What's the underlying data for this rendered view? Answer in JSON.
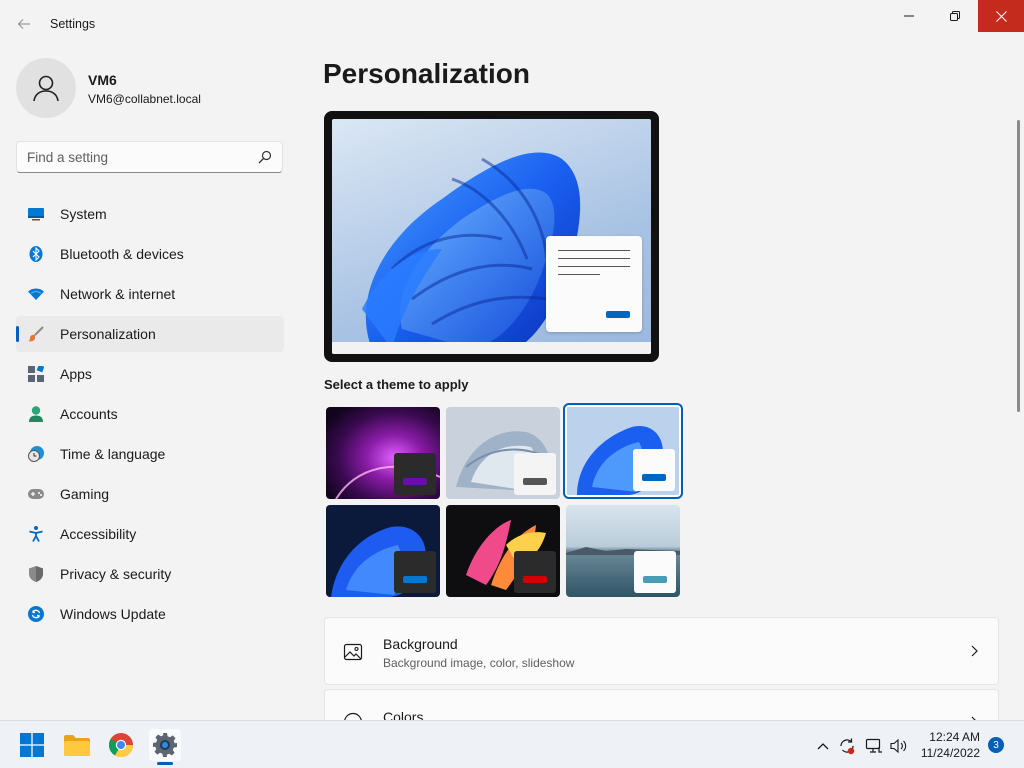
{
  "window": {
    "app_title": "Settings",
    "close_color": "#c42b1c"
  },
  "profile": {
    "name": "VM6",
    "email": "VM6@collabnet.local"
  },
  "search": {
    "placeholder": "Find a setting"
  },
  "sidebar": {
    "items": [
      {
        "label": "System",
        "icon": "system-icon"
      },
      {
        "label": "Bluetooth & devices",
        "icon": "bluetooth-icon"
      },
      {
        "label": "Network & internet",
        "icon": "wifi-icon"
      },
      {
        "label": "Personalization",
        "icon": "brush-icon",
        "active": true
      },
      {
        "label": "Apps",
        "icon": "apps-icon"
      },
      {
        "label": "Accounts",
        "icon": "accounts-icon"
      },
      {
        "label": "Time & language",
        "icon": "clock-globe-icon"
      },
      {
        "label": "Gaming",
        "icon": "gamepad-icon"
      },
      {
        "label": "Accessibility",
        "icon": "accessibility-icon"
      },
      {
        "label": "Privacy & security",
        "icon": "shield-icon"
      },
      {
        "label": "Windows Update",
        "icon": "update-icon"
      }
    ]
  },
  "main": {
    "page_title": "Personalization",
    "theme_heading": "Select a theme to apply",
    "themes": [
      {
        "id": "glow",
        "accent": "#6a0dad",
        "selected": false
      },
      {
        "id": "captured-motion",
        "accent": "#555555",
        "selected": false
      },
      {
        "id": "windows-light",
        "accent": "#0067c0",
        "selected": true
      },
      {
        "id": "windows-dark",
        "accent": "#0078d4",
        "selected": false
      },
      {
        "id": "flow",
        "accent": "#d00000",
        "selected": false
      },
      {
        "id": "sunrise",
        "accent": "#4a9bb5",
        "selected": false
      }
    ],
    "cards": [
      {
        "title": "Background",
        "subtitle": "Background image, color, slideshow",
        "icon": "image-icon"
      },
      {
        "title": "Colors",
        "subtitle": "",
        "icon": "palette-icon"
      }
    ]
  },
  "taskbar": {
    "apps": [
      {
        "name": "start",
        "icon": "windows-start-icon"
      },
      {
        "name": "file-explorer",
        "icon": "folder-icon"
      },
      {
        "name": "chrome",
        "icon": "chrome-icon"
      },
      {
        "name": "settings",
        "icon": "gear-icon",
        "active": true
      }
    ],
    "time": "12:24 AM",
    "date": "11/24/2022",
    "notifications": "3"
  },
  "colors": {
    "accent": "#005fb8"
  }
}
